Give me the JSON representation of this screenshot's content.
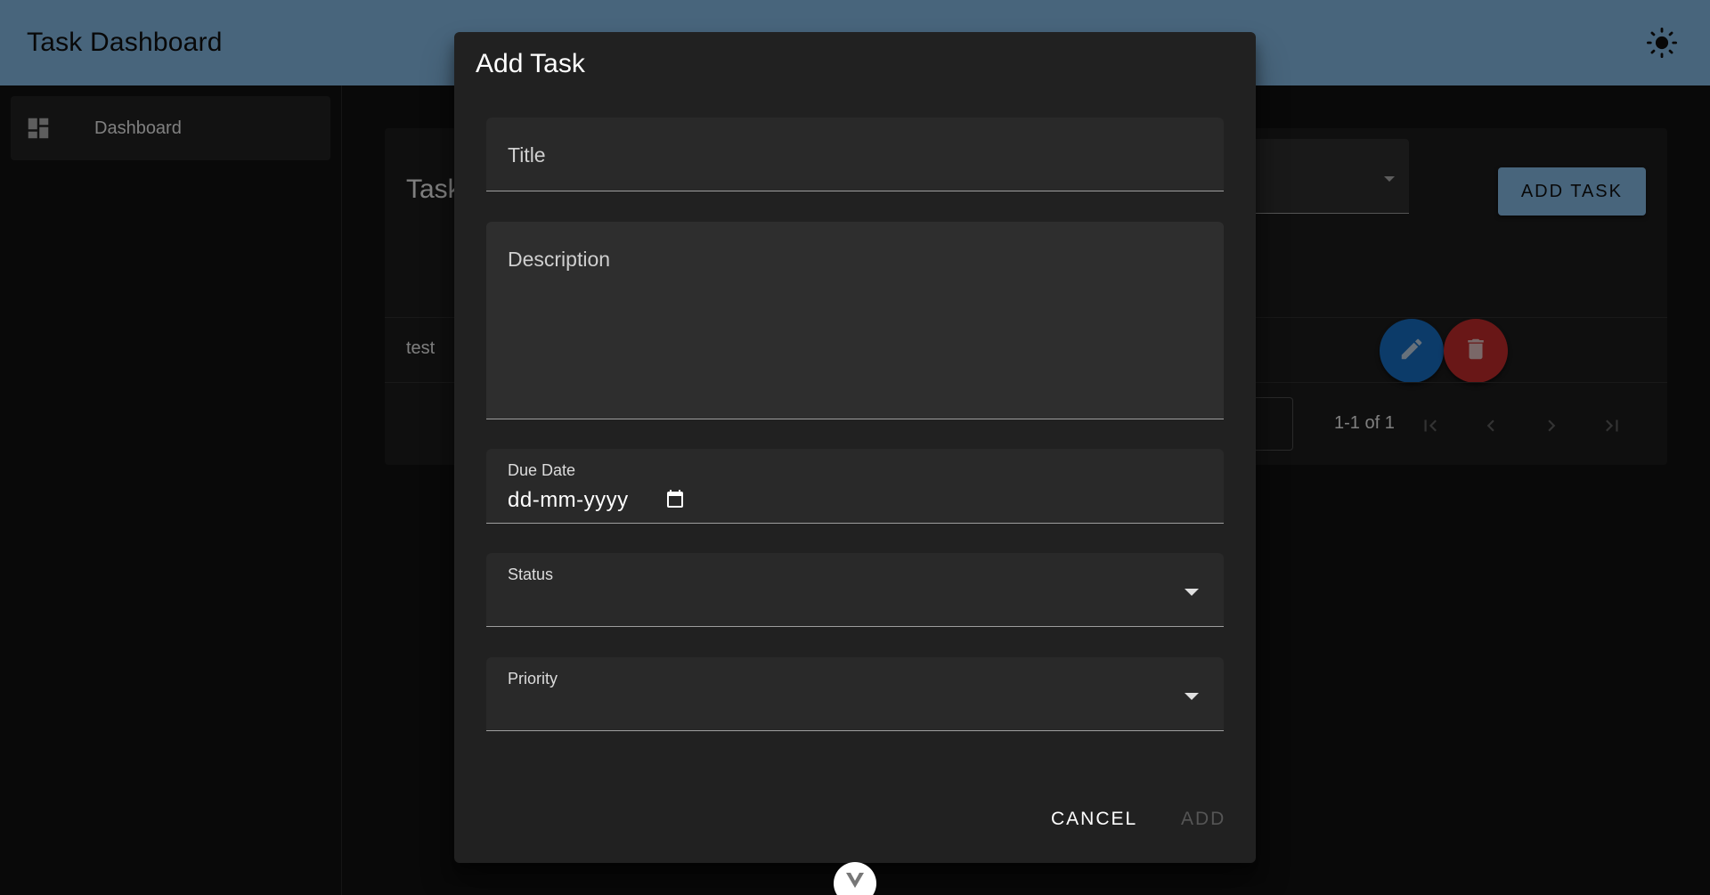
{
  "app": {
    "title": "Task Dashboard"
  },
  "sidebar": {
    "items": [
      {
        "label": "Dashboard",
        "icon": "dashboard-icon"
      }
    ]
  },
  "card": {
    "title": "Tasks",
    "add_button_label": "ADD TASK",
    "rows": [
      {
        "title": "test"
      }
    ],
    "pagination": {
      "info": "1-1 of 1"
    }
  },
  "dialog": {
    "title": "Add Task",
    "fields": {
      "title_placeholder": "Title",
      "description_placeholder": "Description",
      "due_date_label": "Due Date",
      "due_date_value": "dd-mm-yyyy",
      "status_label": "Status",
      "priority_label": "Priority"
    },
    "buttons": {
      "cancel": "CANCEL",
      "add": "ADD"
    }
  },
  "colors": {
    "appbar": "#90caf9",
    "edit_fab": "#1976d2",
    "delete_fab": "#d32f2f",
    "dialog_bg": "#212121"
  }
}
